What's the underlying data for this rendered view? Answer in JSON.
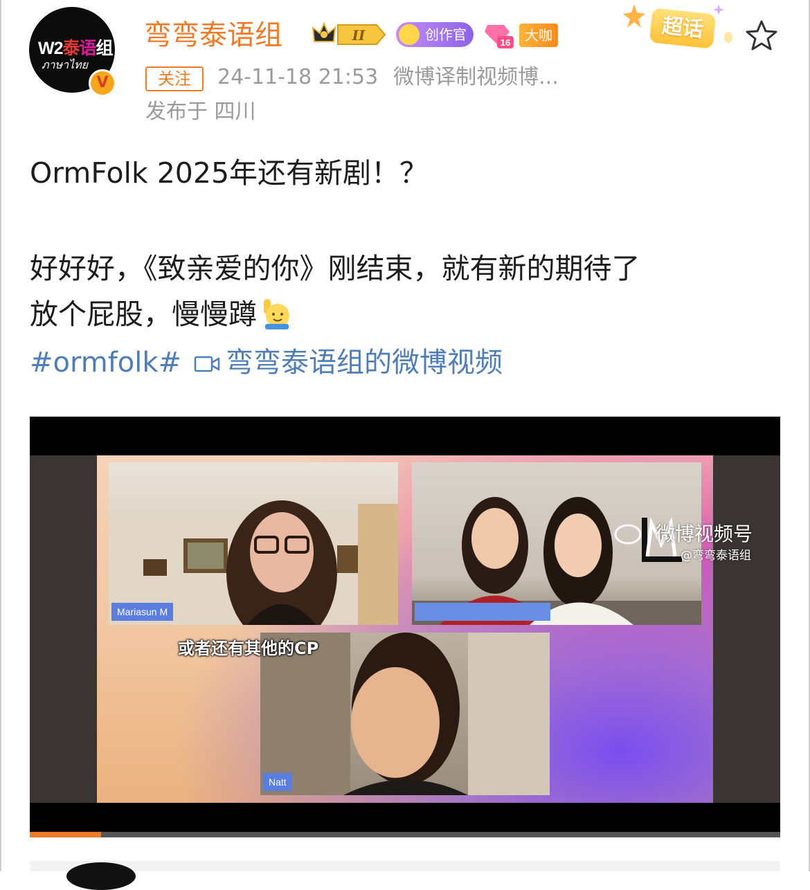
{
  "post": {
    "author": {
      "name": "弯弯泰语组",
      "avatar_text_a": "W2",
      "avatar_text_b": "泰",
      "avatar_text_c": "语",
      "avatar_text_d": "组",
      "avatar_script": "ภาษาไทย",
      "verified_mark": "V",
      "crown_level": "II",
      "creator_badge": "创作官",
      "level_badge": "16",
      "daka_badge": "大咖"
    },
    "super_topic_label": "超话",
    "follow_label": "关注",
    "datetime": "24-11-18 21:53",
    "source": "微博译制视频博...",
    "location": "发布于 四川",
    "content": {
      "line1": "OrmFolk 2025年还有新剧！？",
      "line2": "好好好，《致亲爱的你》刚结束，就有新的期待了",
      "line3": "放个屁股，慢慢蹲",
      "hashtag": "#ormfolk#",
      "video_link": "弯弯泰语组的微博视频"
    },
    "video": {
      "subtitle": "或者还有其他的CP",
      "tile_a_name": "Mariasun M",
      "tile_c_name": "Natt",
      "watermark_title": "微博视频号",
      "watermark_handle": "@弯弯泰语组",
      "progress": 0.095
    }
  },
  "colors": {
    "accent": "#f07a26",
    "link": "#4f7db8",
    "meta": "#9a9a9a",
    "text": "#1d1d1d"
  },
  "icons": [
    "star-icon",
    "video-link-icon",
    "raised-hand-emoji",
    "crown-icon",
    "verified-icon"
  ]
}
